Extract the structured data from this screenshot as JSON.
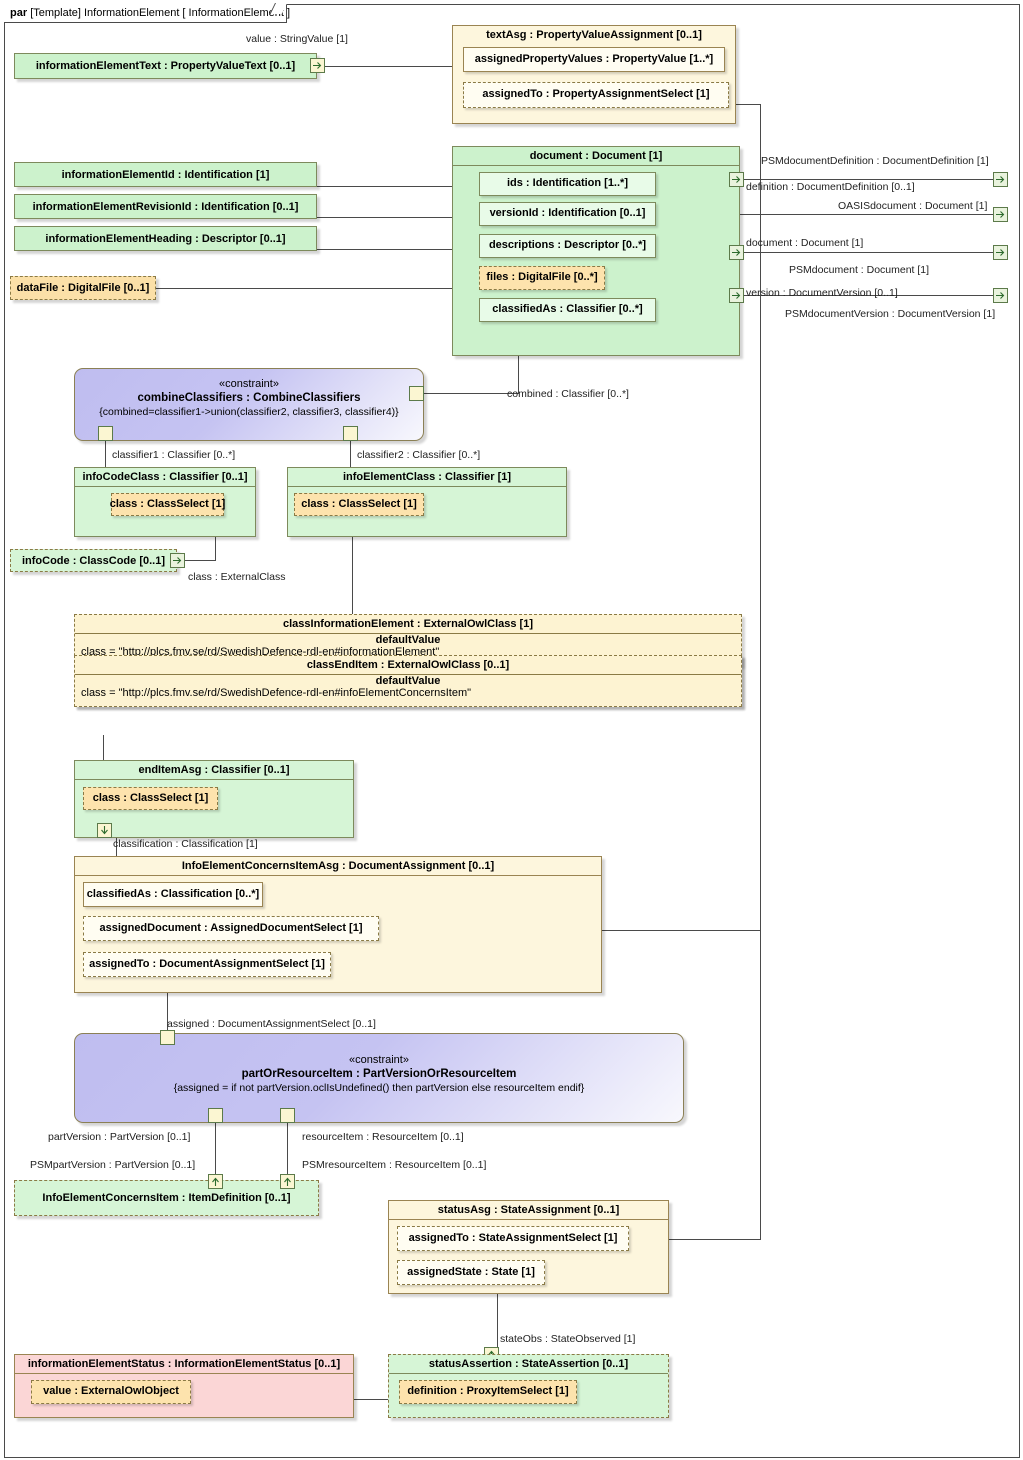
{
  "frame": {
    "keyword": "par",
    "label": "[Template] InformationElement [ InformationElement ]"
  },
  "colors": {
    "green": "#ccf2cc",
    "orange": "#fbe9bd",
    "cream": "#fdf6dd",
    "pink": "#fbd6d6",
    "constraint": "#bfbdf0",
    "border": "#7d8a5c",
    "line": "#4a4a4a"
  },
  "blocks": {
    "information_element_text": {
      "title": "informationElementText : PropertyValueText [0..1]"
    },
    "text_asg": {
      "title": "textAsg : PropertyValueAssignment [0..1]",
      "properties": [
        "assignedPropertyValues : PropertyValue [1..*]",
        "assignedTo : PropertyAssignmentSelect [1]"
      ]
    },
    "information_element_id": {
      "title": "informationElementId : Identification [1]"
    },
    "information_element_revision_id": {
      "title": "informationElementRevisionId : Identification [0..1]"
    },
    "information_element_heading": {
      "title": "informationElementHeading : Descriptor [0..1]"
    },
    "data_file": {
      "title": "dataFile : DigitalFile [0..1]"
    },
    "document": {
      "title": "document : Document [1]",
      "properties": [
        "ids : Identification [1..*]",
        "versionId : Identification [0..1]",
        "descriptions : Descriptor [0..*]",
        "files : DigitalFile [0..*]",
        "classifiedAs : Classifier [0..*]"
      ]
    },
    "combine_classifiers": {
      "stereotype": "«constraint»",
      "name": "combineClassifiers : CombineClassifiers",
      "expression": "{combined=classifier1->union(classifier2, classifier3, classifier4)}"
    },
    "info_code_class": {
      "title": "infoCodeClass : Classifier [0..1]",
      "properties": [
        "class : ClassSelect [1]"
      ]
    },
    "info_element_class": {
      "title": "infoElementClass : Classifier [1]",
      "properties": [
        "class : ClassSelect [1]"
      ]
    },
    "info_code": {
      "title": "infoCode : ClassCode [0..1]"
    },
    "class_information_element": {
      "title": "classInformationElement : ExternalOwlClass [1]",
      "default_label": "defaultValue",
      "default_value": "class = \"http://plcs.fmv.se/rd/SwedishDefence-rdl-en#informationElement\""
    },
    "class_end_item": {
      "title": "classEndItem : ExternalOwlClass [0..1]",
      "default_label": "defaultValue",
      "default_value": "class = \"http://plcs.fmv.se/rd/SwedishDefence-rdl-en#infoElementConcernsItem\""
    },
    "end_item_asg": {
      "title": "endItemAsg : Classifier [0..1]",
      "properties": [
        "class : ClassSelect [1]"
      ]
    },
    "info_element_concerns_item_asg": {
      "title": "InfoElementConcernsItemAsg : DocumentAssignment [0..1]",
      "properties": [
        "classifiedAs : Classification [0..*]",
        "assignedDocument : AssignedDocumentSelect [1]",
        "assignedTo : DocumentAssignmentSelect [1]"
      ]
    },
    "part_or_resource_item": {
      "stereotype": "«constraint»",
      "name": "partOrResourceItem : PartVersionOrResourceItem",
      "expression": "{assigned = if not partVersion.oclIsUndefined() then partVersion else resourceItem endif}"
    },
    "info_element_concerns_item": {
      "title": "InfoElementConcernsItem : ItemDefinition [0..1]"
    },
    "status_asg": {
      "title": "statusAsg : StateAssignment [0..1]",
      "properties": [
        "assignedTo : StateAssignmentSelect [1]",
        "assignedState : State [1]"
      ]
    },
    "information_element_status": {
      "title": "informationElementStatus : InformationElementStatus [0..1]",
      "properties": [
        "value : ExternalOwlObject"
      ]
    },
    "status_assertion": {
      "title": "statusAssertion : StateAssertion [0..1]",
      "properties": [
        "definition : ProxyItemSelect [1]"
      ]
    }
  },
  "edge_labels": {
    "value_string_value": "value : StringValue [1]",
    "psm_document_definition": "PSMdocumentDefinition : DocumentDefinition [1]",
    "definition_document_definition": "definition : DocumentDefinition [0..1]",
    "oasis_document": "OASISdocument : Document [1]",
    "document_document": "document : Document [1]",
    "psm_document": "PSMdocument : Document [1]",
    "version_document_version": "version : DocumentVersion [0..1]",
    "psm_document_version": "PSMdocumentVersion : DocumentVersion [1]",
    "combined_classifier": "combined : Classifier [0..*]",
    "classifier1": "classifier1 : Classifier [0..*]",
    "classifier2": "classifier2 : Classifier [0..*]",
    "class_external_class": "class : ExternalClass",
    "classification": "classification : Classification [1]",
    "assigned_document_assignment_select": "assigned : DocumentAssignmentSelect [0..1]",
    "part_version": "partVersion : PartVersion [0..1]",
    "psm_part_version": "PSMpartVersion : PartVersion [0..1]",
    "resource_item": "resourceItem : ResourceItem [0..1]",
    "psm_resource_item": "PSMresourceItem : ResourceItem [0..1]",
    "state_obs": "stateObs : StateObserved [1]"
  }
}
